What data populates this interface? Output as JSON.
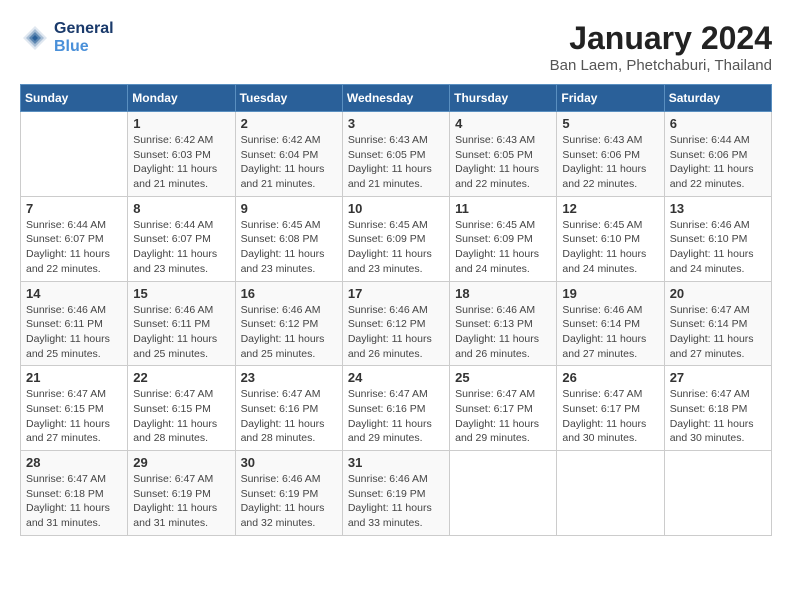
{
  "header": {
    "logo_line1": "General",
    "logo_line2": "Blue",
    "month_title": "January 2024",
    "location": "Ban Laem, Phetchaburi, Thailand"
  },
  "weekdays": [
    "Sunday",
    "Monday",
    "Tuesday",
    "Wednesday",
    "Thursday",
    "Friday",
    "Saturday"
  ],
  "weeks": [
    [
      {
        "day": "",
        "sunrise": "",
        "sunset": "",
        "daylight": ""
      },
      {
        "day": "1",
        "sunrise": "Sunrise: 6:42 AM",
        "sunset": "Sunset: 6:03 PM",
        "daylight": "Daylight: 11 hours and 21 minutes."
      },
      {
        "day": "2",
        "sunrise": "Sunrise: 6:42 AM",
        "sunset": "Sunset: 6:04 PM",
        "daylight": "Daylight: 11 hours and 21 minutes."
      },
      {
        "day": "3",
        "sunrise": "Sunrise: 6:43 AM",
        "sunset": "Sunset: 6:05 PM",
        "daylight": "Daylight: 11 hours and 21 minutes."
      },
      {
        "day": "4",
        "sunrise": "Sunrise: 6:43 AM",
        "sunset": "Sunset: 6:05 PM",
        "daylight": "Daylight: 11 hours and 22 minutes."
      },
      {
        "day": "5",
        "sunrise": "Sunrise: 6:43 AM",
        "sunset": "Sunset: 6:06 PM",
        "daylight": "Daylight: 11 hours and 22 minutes."
      },
      {
        "day": "6",
        "sunrise": "Sunrise: 6:44 AM",
        "sunset": "Sunset: 6:06 PM",
        "daylight": "Daylight: 11 hours and 22 minutes."
      }
    ],
    [
      {
        "day": "7",
        "sunrise": "Sunrise: 6:44 AM",
        "sunset": "Sunset: 6:07 PM",
        "daylight": "Daylight: 11 hours and 22 minutes."
      },
      {
        "day": "8",
        "sunrise": "Sunrise: 6:44 AM",
        "sunset": "Sunset: 6:07 PM",
        "daylight": "Daylight: 11 hours and 23 minutes."
      },
      {
        "day": "9",
        "sunrise": "Sunrise: 6:45 AM",
        "sunset": "Sunset: 6:08 PM",
        "daylight": "Daylight: 11 hours and 23 minutes."
      },
      {
        "day": "10",
        "sunrise": "Sunrise: 6:45 AM",
        "sunset": "Sunset: 6:09 PM",
        "daylight": "Daylight: 11 hours and 23 minutes."
      },
      {
        "day": "11",
        "sunrise": "Sunrise: 6:45 AM",
        "sunset": "Sunset: 6:09 PM",
        "daylight": "Daylight: 11 hours and 24 minutes."
      },
      {
        "day": "12",
        "sunrise": "Sunrise: 6:45 AM",
        "sunset": "Sunset: 6:10 PM",
        "daylight": "Daylight: 11 hours and 24 minutes."
      },
      {
        "day": "13",
        "sunrise": "Sunrise: 6:46 AM",
        "sunset": "Sunset: 6:10 PM",
        "daylight": "Daylight: 11 hours and 24 minutes."
      }
    ],
    [
      {
        "day": "14",
        "sunrise": "Sunrise: 6:46 AM",
        "sunset": "Sunset: 6:11 PM",
        "daylight": "Daylight: 11 hours and 25 minutes."
      },
      {
        "day": "15",
        "sunrise": "Sunrise: 6:46 AM",
        "sunset": "Sunset: 6:11 PM",
        "daylight": "Daylight: 11 hours and 25 minutes."
      },
      {
        "day": "16",
        "sunrise": "Sunrise: 6:46 AM",
        "sunset": "Sunset: 6:12 PM",
        "daylight": "Daylight: 11 hours and 25 minutes."
      },
      {
        "day": "17",
        "sunrise": "Sunrise: 6:46 AM",
        "sunset": "Sunset: 6:12 PM",
        "daylight": "Daylight: 11 hours and 26 minutes."
      },
      {
        "day": "18",
        "sunrise": "Sunrise: 6:46 AM",
        "sunset": "Sunset: 6:13 PM",
        "daylight": "Daylight: 11 hours and 26 minutes."
      },
      {
        "day": "19",
        "sunrise": "Sunrise: 6:46 AM",
        "sunset": "Sunset: 6:14 PM",
        "daylight": "Daylight: 11 hours and 27 minutes."
      },
      {
        "day": "20",
        "sunrise": "Sunrise: 6:47 AM",
        "sunset": "Sunset: 6:14 PM",
        "daylight": "Daylight: 11 hours and 27 minutes."
      }
    ],
    [
      {
        "day": "21",
        "sunrise": "Sunrise: 6:47 AM",
        "sunset": "Sunset: 6:15 PM",
        "daylight": "Daylight: 11 hours and 27 minutes."
      },
      {
        "day": "22",
        "sunrise": "Sunrise: 6:47 AM",
        "sunset": "Sunset: 6:15 PM",
        "daylight": "Daylight: 11 hours and 28 minutes."
      },
      {
        "day": "23",
        "sunrise": "Sunrise: 6:47 AM",
        "sunset": "Sunset: 6:16 PM",
        "daylight": "Daylight: 11 hours and 28 minutes."
      },
      {
        "day": "24",
        "sunrise": "Sunrise: 6:47 AM",
        "sunset": "Sunset: 6:16 PM",
        "daylight": "Daylight: 11 hours and 29 minutes."
      },
      {
        "day": "25",
        "sunrise": "Sunrise: 6:47 AM",
        "sunset": "Sunset: 6:17 PM",
        "daylight": "Daylight: 11 hours and 29 minutes."
      },
      {
        "day": "26",
        "sunrise": "Sunrise: 6:47 AM",
        "sunset": "Sunset: 6:17 PM",
        "daylight": "Daylight: 11 hours and 30 minutes."
      },
      {
        "day": "27",
        "sunrise": "Sunrise: 6:47 AM",
        "sunset": "Sunset: 6:18 PM",
        "daylight": "Daylight: 11 hours and 30 minutes."
      }
    ],
    [
      {
        "day": "28",
        "sunrise": "Sunrise: 6:47 AM",
        "sunset": "Sunset: 6:18 PM",
        "daylight": "Daylight: 11 hours and 31 minutes."
      },
      {
        "day": "29",
        "sunrise": "Sunrise: 6:47 AM",
        "sunset": "Sunset: 6:19 PM",
        "daylight": "Daylight: 11 hours and 31 minutes."
      },
      {
        "day": "30",
        "sunrise": "Sunrise: 6:46 AM",
        "sunset": "Sunset: 6:19 PM",
        "daylight": "Daylight: 11 hours and 32 minutes."
      },
      {
        "day": "31",
        "sunrise": "Sunrise: 6:46 AM",
        "sunset": "Sunset: 6:19 PM",
        "daylight": "Daylight: 11 hours and 33 minutes."
      },
      {
        "day": "",
        "sunrise": "",
        "sunset": "",
        "daylight": ""
      },
      {
        "day": "",
        "sunrise": "",
        "sunset": "",
        "daylight": ""
      },
      {
        "day": "",
        "sunrise": "",
        "sunset": "",
        "daylight": ""
      }
    ]
  ]
}
